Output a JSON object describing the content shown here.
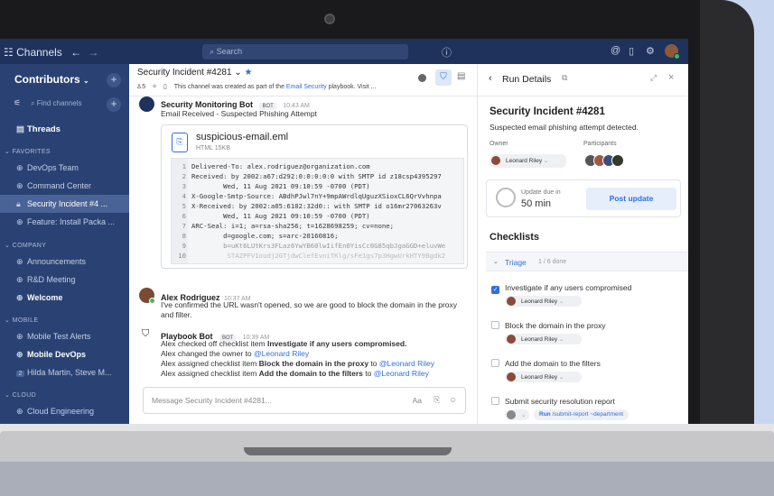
{
  "topbar": {
    "channels_label": "Channels",
    "search_placeholder": "Search"
  },
  "sidebar": {
    "team": "Contributors",
    "find_placeholder": "Find channels",
    "threads": "Threads",
    "sections": [
      {
        "title": "FAVORITES",
        "items": [
          {
            "label": "DevOps Team"
          },
          {
            "label": "Command Center"
          },
          {
            "label": "Security Incident #4 ...",
            "active": true
          },
          {
            "label": "Feature: Install Packa ..."
          }
        ]
      },
      {
        "title": "COMPANY",
        "items": [
          {
            "label": "Announcements"
          },
          {
            "label": "R&D Meeting"
          },
          {
            "label": "Welcome",
            "bold": true
          }
        ]
      },
      {
        "title": "MOBILE",
        "items": [
          {
            "label": "Mobile Test Alerts"
          },
          {
            "label": "Mobile DevOps",
            "bold": true
          },
          {
            "label": "Hilda Martin, Steve M...",
            "badge": "2"
          }
        ]
      },
      {
        "title": "CLOUD",
        "items": [
          {
            "label": "Cloud Engineering"
          }
        ]
      }
    ]
  },
  "channel": {
    "title": "Security Incident #4281",
    "member_count": "5",
    "subtitle_prefix": "This channel was created as part of the",
    "subtitle_link": "Email Security",
    "subtitle_suffix": "playbook. Visit ...",
    "composer_placeholder": "Message Security Incident #4281...",
    "composer_format": "Aa"
  },
  "messages": {
    "monitoring": {
      "author": "Security Monitoring Bot",
      "badge": "BOT",
      "time": "10:43 AM",
      "text": "Email Received - Suspected Phishing Attempt"
    },
    "file": {
      "name": "suspicious-email.eml",
      "meta": "HTML 15KB",
      "lines": [
        "Delivered-To: alex.rodriguez@organization.com",
        "Received: by 2002:a67:d292:0:0:0:0:0 with SMTP id z18csp4395297",
        "        Wed, 11 Aug 2021 09:10:59 -0700 (PDT)",
        "X-Google-Smtp-Source: ABdhPJwl7nY+9mpAWrdlqUguzXSioxCL6QrVvhnpa",
        "X-Received: by 2002:a05:6102:32d0:: with SMTP id o16mr27063263v",
        "        Wed, 11 Aug 2021 09:10:59 -0700 (PDT)",
        "ARC-Seal: i=1; a=rsa-sha256; t=1628698259; cv=none;",
        "        d=google.com; s=arc-20160816;",
        "        b=uKt6LUtKrs3FLaz6YwYB60lwIifEn0YisCc0G85qbJgaGGD+eluvWe",
        "         STAZPFV1oudj2GTjdwClefEvniTKlg/sFe1gs7p3HgwUrkHTY9Bgdk2"
      ]
    },
    "alex": {
      "author": "Alex Rodriguez",
      "time": "10:37 AM",
      "text": "I've confirmed the URL wasn't opened, so we are good to block the domain in the proxy and filter."
    },
    "playbook": {
      "author": "Playbook Bot",
      "badge": "BOT",
      "time": "10:39 AM",
      "l1_prefix": "Alex checked off checklist item",
      "l1_bold": "Investigate if any users compromised.",
      "l2_prefix": "Alex changed the owner to",
      "l2_link": "@Leonard Riley",
      "l3_prefix": "Alex assigned checklist item",
      "l3_bold": "Block the domain in the proxy",
      "l3_mid": "to",
      "l3_link": "@Leonard Riley",
      "l4_prefix": "Alex assigned checklist item",
      "l4_bold": "Add the domain to the filters",
      "l4_mid": "to",
      "l4_link": "@Leonard Riley"
    }
  },
  "run": {
    "header": "Run Details",
    "title": "Security Incident #4281",
    "description": "Suspected email phishing attempt detected.",
    "owner_label": "Owner",
    "owner": "Leonard Riley",
    "participants_label": "Participants",
    "update_label": "Update due in",
    "update_value": "50 min",
    "post_update": "Post update",
    "checklists_title": "Checklists",
    "triage": "Triage",
    "triage_progress": "1 / 6 done",
    "items": [
      {
        "label": "Investigate if any users compromised",
        "assignee": "Leonard Riley",
        "checked": true
      },
      {
        "label": "Block the domain in the proxy",
        "assignee": "Leonard Riley",
        "checked": false
      },
      {
        "label": "Add the domain to the filters",
        "assignee": "Leonard Riley",
        "checked": false
      },
      {
        "label": "Submit security resolution report",
        "checked": false,
        "run_label": "Run",
        "command": "/submit-report ~department"
      }
    ]
  },
  "colors": {
    "navy": "#1e325c",
    "sidebar": "#2a4273",
    "accent": "#2f6fe0"
  }
}
